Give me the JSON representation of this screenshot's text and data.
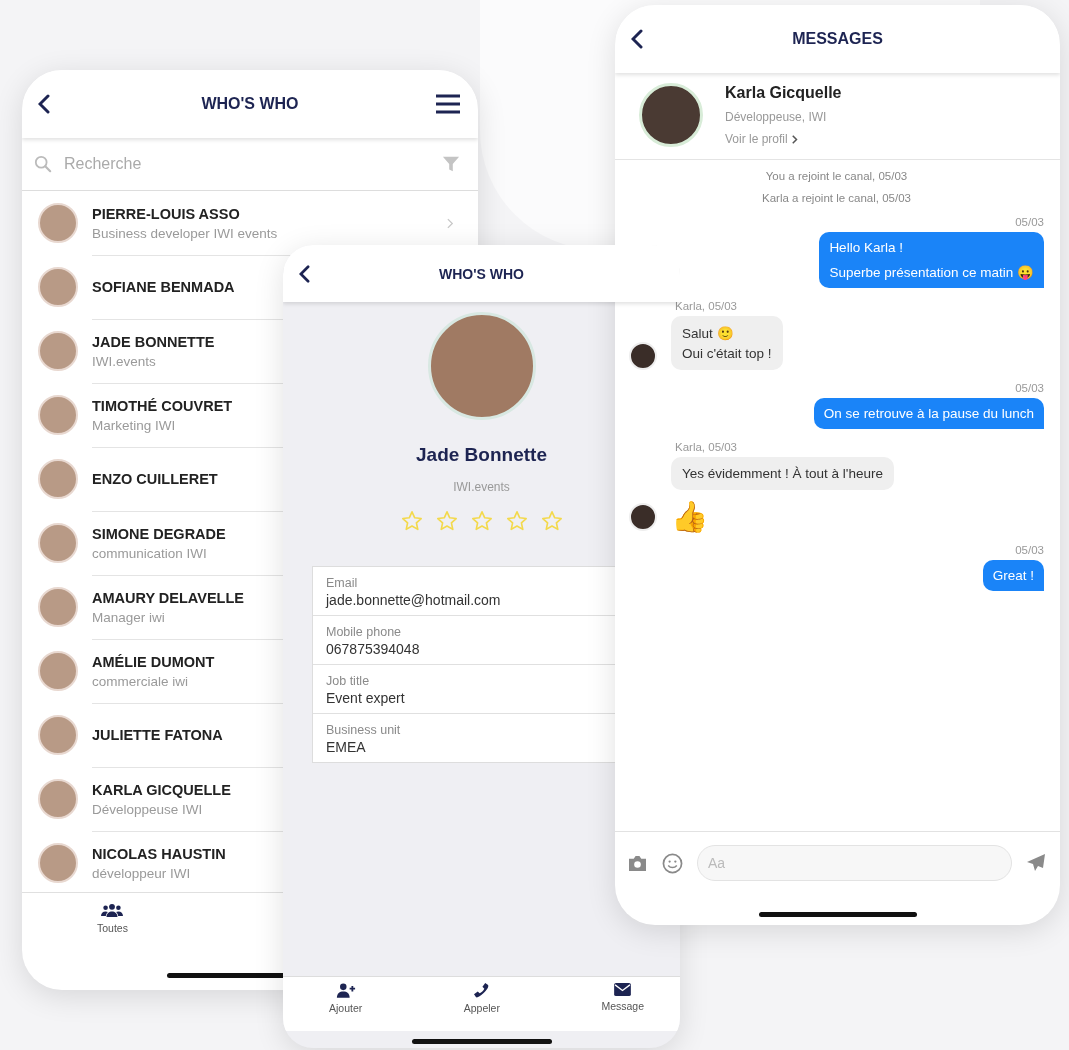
{
  "directory": {
    "title": "WHO'S WHO",
    "search": {
      "placeholder": "Recherche"
    },
    "contacts": [
      {
        "name": "PIERRE-LOUIS ASSO",
        "subtitle": "Business developer IWI events"
      },
      {
        "name": "SOFIANE BENMADA"
      },
      {
        "name": "JADE BONNETTE",
        "subtitle": "IWI.events"
      },
      {
        "name": "TIMOTHÉ COUVRET",
        "subtitle": "Marketing IWI"
      },
      {
        "name": "ENZO CUILLERET"
      },
      {
        "name": "SIMONE DEGRADE",
        "subtitle": "communication IWI"
      },
      {
        "name": "AMAURY DELAVELLE",
        "subtitle": "Manager iwi"
      },
      {
        "name": "AMÉLIE DUMONT",
        "subtitle": "commerciale iwi"
      },
      {
        "name": "JULIETTE FATONA"
      },
      {
        "name": "KARLA GICQUELLE",
        "subtitle": "Développeuse IWI"
      },
      {
        "name": "NICOLAS HAUSTIN",
        "subtitle": "développeur IWI"
      }
    ],
    "nav": [
      {
        "label": "Toutes",
        "kind": "people"
      }
    ]
  },
  "profile": {
    "title": "WHO'S WHO",
    "name": "Jade Bonnette",
    "company": "IWI.events",
    "stars": 0,
    "fields": [
      {
        "label": "Email",
        "value": "jade.bonnette@hotmail.com"
      },
      {
        "label": "Mobile phone",
        "value": "067875394048"
      },
      {
        "label": "Job title",
        "value": "Event expert"
      },
      {
        "label": "Business unit",
        "value": "EMEA"
      }
    ],
    "actions": [
      {
        "label": "Ajouter",
        "kind": "add"
      },
      {
        "label": "Appeler",
        "kind": "call"
      },
      {
        "label": "Message",
        "kind": "message"
      }
    ]
  },
  "messages": {
    "title": "MESSAGES",
    "contact": {
      "name": "Karla Gicquelle",
      "role": "Développeuse, IWI",
      "link": "Voir le profil"
    },
    "feed": [
      {
        "kind": "system",
        "text": "You a rejoint le canal, 05/03"
      },
      {
        "kind": "system",
        "text": "Karla a rejoint le canal, 05/03"
      },
      {
        "kind": "sent",
        "time": "05/03",
        "lines": [
          "Hello Karla !",
          "Superbe présentation ce matin 😛"
        ]
      },
      {
        "kind": "received",
        "meta": "Karla, 05/03",
        "lines": [
          "Salut 🙂",
          "Oui c'était top !"
        ],
        "avatar": true
      },
      {
        "kind": "sent",
        "time": "05/03",
        "lines": [
          "On se retrouve à la pause du lunch"
        ]
      },
      {
        "kind": "received",
        "meta": "Karla, 05/03",
        "lines": [
          "Yes évidemment ! À tout à l'heure"
        ],
        "avatar": false
      },
      {
        "kind": "emoji",
        "text": "👍",
        "avatar": true
      },
      {
        "kind": "sent",
        "time": "05/03",
        "lines": [
          "Great !"
        ]
      }
    ],
    "input": {
      "placeholder": "Aa"
    }
  }
}
